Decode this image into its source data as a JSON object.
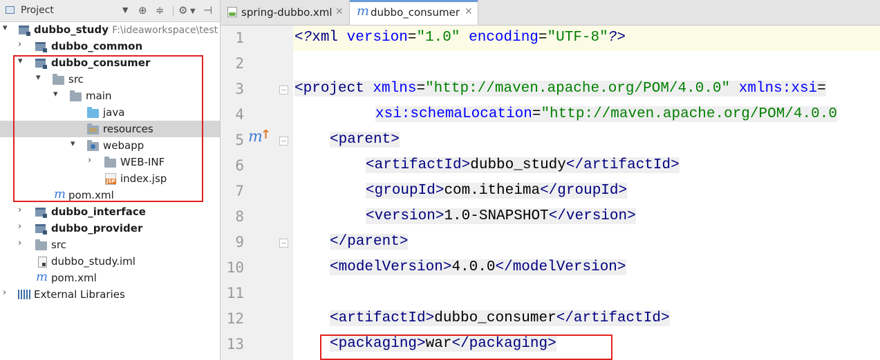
{
  "project_panel": {
    "title": "Project",
    "tree": [
      {
        "label": "dubbo_study",
        "path": "F:\\ideaworkspace\\test"
      },
      {
        "label": "dubbo_common"
      },
      {
        "label": "dubbo_consumer"
      },
      {
        "label": "src"
      },
      {
        "label": "main"
      },
      {
        "label": "java"
      },
      {
        "label": "resources"
      },
      {
        "label": "webapp"
      },
      {
        "label": "WEB-INF"
      },
      {
        "label": "index.jsp",
        "icon_text": "JSP"
      },
      {
        "label": "pom.xml"
      },
      {
        "label": "dubbo_interface"
      },
      {
        "label": "dubbo_provider"
      },
      {
        "label": "src"
      },
      {
        "label": "dubbo_study.iml"
      },
      {
        "label": "pom.xml"
      },
      {
        "label": "External Libraries"
      }
    ]
  },
  "editor": {
    "tabs": [
      {
        "label": "spring-dubbo.xml",
        "active": false
      },
      {
        "label": "dubbo_consumer",
        "active": true
      }
    ],
    "lines": [
      {
        "num": "1",
        "c": [
          "<?",
          "xml",
          " version",
          "=",
          "\"1.0\"",
          " encoding",
          "=",
          "\"UTF-8\"",
          "?>"
        ]
      },
      {
        "num": "2"
      },
      {
        "num": "3",
        "c": [
          "<",
          "project",
          " xmlns",
          "=",
          "\"http://maven.apache.org/POM/4.0.0\"",
          " xmlns:xsi",
          "="
        ]
      },
      {
        "num": "4",
        "c": [
          "xsi:schemaLocation",
          "=",
          "\"http://maven.apache.org/POM/4.0.0"
        ]
      },
      {
        "num": "5",
        "c": [
          "<",
          "parent",
          ">"
        ]
      },
      {
        "num": "6",
        "c": [
          "<",
          "artifactId",
          ">",
          "dubbo_study",
          "</",
          "artifactId",
          ">"
        ]
      },
      {
        "num": "7",
        "c": [
          "<",
          "groupId",
          ">",
          "com.itheima",
          "</",
          "groupId",
          ">"
        ]
      },
      {
        "num": "8",
        "c": [
          "<",
          "version",
          ">",
          "1.0-SNAPSHOT",
          "</",
          "version",
          ">"
        ]
      },
      {
        "num": "9",
        "c": [
          "</",
          "parent",
          ">"
        ]
      },
      {
        "num": "10",
        "c": [
          "<",
          "modelVersion",
          ">",
          "4.0.0",
          "</",
          "modelVersion",
          ">"
        ]
      },
      {
        "num": "11"
      },
      {
        "num": "12",
        "c": [
          "<",
          "artifactId",
          ">",
          "dubbo_consumer",
          "</",
          "artifactId",
          ">"
        ]
      },
      {
        "num": "13",
        "c": [
          "<",
          "packaging",
          ">",
          "war",
          "</",
          "packaging",
          ">"
        ]
      }
    ]
  },
  "colors": {
    "tag": "#000080",
    "attribute": "#0000ff",
    "value": "#008000",
    "highlight_box": "#e02020",
    "selection": "#d5d5d5"
  }
}
